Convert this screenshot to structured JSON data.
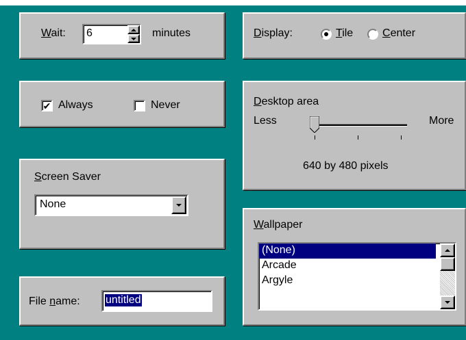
{
  "wait": {
    "label_prefix": "W",
    "label_rest": "ait:",
    "value": "6",
    "unit": "minutes"
  },
  "always_never": {
    "always_label": "Always",
    "always_checked": true,
    "never_label": "Never",
    "never_checked": false
  },
  "screen_saver": {
    "label_prefix": "S",
    "label_rest": "creen Saver",
    "selected": "None"
  },
  "file_name": {
    "label_a": "File ",
    "label_u": "n",
    "label_b": "ame:",
    "value": "untitled"
  },
  "display": {
    "label_prefix": "D",
    "label_rest": "isplay:",
    "tile_u": "T",
    "tile_rest": "ile",
    "tile_selected": true,
    "center_u": "C",
    "center_rest": "enter",
    "center_selected": false
  },
  "desktop_area": {
    "label_prefix": "D",
    "label_rest": "esktop area",
    "less_label": "Less",
    "more_label": "More",
    "resolution_text": "640 by 480 pixels",
    "slider_level": 0.0
  },
  "wallpaper": {
    "label_prefix": "W",
    "label_rest": "allpaper",
    "items": [
      "(None)",
      "Arcade",
      "Argyle"
    ],
    "selected_index": 0
  },
  "colors": {
    "desktop": "#008080",
    "highlight": "#000080",
    "face": "#c0c0c0"
  }
}
